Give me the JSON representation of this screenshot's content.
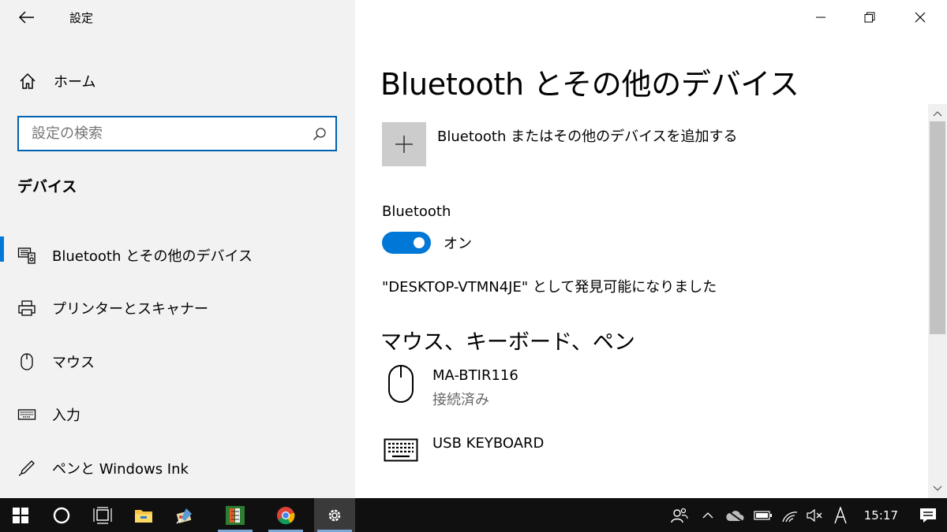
{
  "window": {
    "title": "設定"
  },
  "sidebar": {
    "home_label": "ホーム",
    "search_placeholder": "設定の検索",
    "section_title": "デバイス",
    "items": [
      {
        "label": "Bluetooth とその他のデバイス",
        "icon": "bluetooth-devices-icon",
        "active": true
      },
      {
        "label": "プリンターとスキャナー",
        "icon": "printer-icon"
      },
      {
        "label": "マウス",
        "icon": "mouse-icon"
      },
      {
        "label": "入力",
        "icon": "keyboard-icon"
      },
      {
        "label": "ペンと Windows Ink",
        "icon": "pen-icon"
      }
    ]
  },
  "main": {
    "title": "Bluetooth とその他のデバイス",
    "add_device_label": "Bluetooth またはその他のデバイスを追加する",
    "bluetooth_label": "Bluetooth",
    "toggle_state": "オン",
    "discoverable_text": "\"DESKTOP-VTMN4JE\" として発見可能になりました",
    "group_title": "マウス、キーボード、ペン",
    "devices": [
      {
        "name": "MA-BTIR116",
        "status": "接続済み",
        "icon": "mouse-icon"
      },
      {
        "name": "USB KEYBOARD",
        "status": "",
        "icon": "keyboard-icon"
      }
    ]
  },
  "taskbar": {
    "time": "15:17",
    "colors": {
      "background": "#101010",
      "accent": "#0078d7"
    }
  }
}
